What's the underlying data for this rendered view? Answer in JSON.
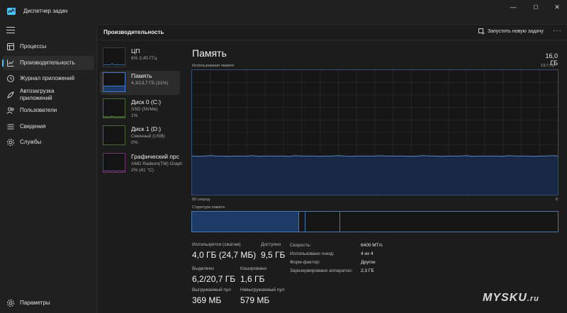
{
  "window": {
    "title": "Диспетчер задач",
    "controls": [
      "—",
      "☐",
      "✕"
    ]
  },
  "nav": {
    "items": [
      {
        "label": "Процессы",
        "icon": "processes-icon"
      },
      {
        "label": "Производительность",
        "icon": "performance-icon",
        "active": true
      },
      {
        "label": "Журнал приложений",
        "icon": "app-history-icon"
      },
      {
        "label": "Автозагрузка",
        "label2": "приложений",
        "icon": "startup-icon"
      },
      {
        "label": "Пользователи",
        "icon": "users-icon"
      },
      {
        "label": "Сведения",
        "icon": "details-icon"
      },
      {
        "label": "Службы",
        "icon": "services-icon"
      }
    ],
    "settings": "Параметры"
  },
  "header": {
    "title": "Производительность",
    "run_task": "Запустить новую задачу",
    "more": "···"
  },
  "devices": [
    {
      "name": "ЦП",
      "sub1": "6%  2,45 ГГц",
      "sub2": "",
      "color": "#3b8fd6"
    },
    {
      "name": "Память",
      "sub1": "4,3/13,7 ГБ (31%)",
      "sub2": "",
      "color": "#4a78c8",
      "active": true
    },
    {
      "name": "Диск 0 (C:)",
      "sub1": "SSD (NVMe)",
      "sub2": "1%",
      "color": "#7cc248"
    },
    {
      "name": "Диск 1 (D:)",
      "sub1": "Сменный (USB)",
      "sub2": "0%",
      "color": "#7cc248"
    },
    {
      "name": "Графический прс",
      "sub1": "AMD Radeon(TM) Graphics",
      "sub2": "2% (41 °C)",
      "color": "#b357c8"
    }
  ],
  "detail": {
    "title": "Память",
    "total": "16,0 ГБ",
    "usage_label": "Использование памяти",
    "usage_max": "13,7 ГБ",
    "time_left": "60 секунд",
    "time_right": "0",
    "usage_fraction": 0.31,
    "structure_label": "Структура памяти",
    "structure_fractions": {
      "in_use": 0.293,
      "modified": 0.017,
      "standby": 0.095
    }
  },
  "stats": {
    "in_use_label": "Используется (сжатая)",
    "in_use_value": "4,0 ГБ (24,7 МБ)",
    "available_label": "Доступно",
    "available_value": "9,5 ГБ",
    "committed_label": "Выделено",
    "committed_value": "6,2/20,7 ГБ",
    "cached_label": "Кэшировано",
    "cached_value": "1,6 ГБ",
    "paged_label": "Выгружаемый пул",
    "paged_value": "369 МБ",
    "nonpaged_label": "Невыгружаемый пул",
    "nonpaged_value": "579 МБ"
  },
  "props": [
    {
      "key": "Скорость:",
      "value": "6400 МТ/с"
    },
    {
      "key": "Использовано гнезд:",
      "value": "4 из 4"
    },
    {
      "key": "Форм-фактор:",
      "value": "Другое"
    },
    {
      "key": "Зарезервировано аппаратно:",
      "value": "2,3 ГБ"
    }
  ],
  "watermark": "MYSKU",
  "watermark_suffix": ".ru"
}
